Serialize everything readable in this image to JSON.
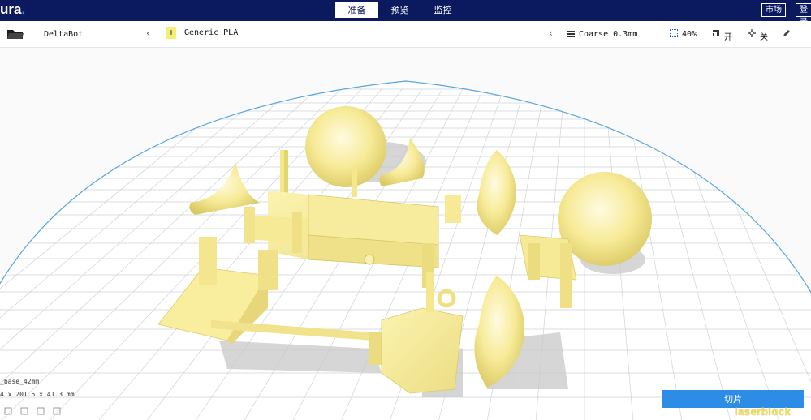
{
  "header": {
    "logo_text": "ura",
    "logo_dot": ".",
    "stages": [
      {
        "label": "准备",
        "active": true
      },
      {
        "label": "预览",
        "active": false
      },
      {
        "label": "监控",
        "active": false
      }
    ],
    "marketplace_label": "市场",
    "login_label": "登录"
  },
  "toolbar": {
    "printer_name": "DeltaBot",
    "material_name": "Generic PLA",
    "profile": "Coarse 0.3mm",
    "infill": "40%",
    "support": "开",
    "adhesion": "关"
  },
  "model_info": {
    "name": "_base_42mm",
    "dimensions": "4 x 201.5 x 41.3 mm"
  },
  "slice_button_label": "切片",
  "watermark_text": "laserblock",
  "colors": {
    "header_bg": "#0b1a5e",
    "model_color": "#f7ee9a",
    "slice_button": "#2d8ce6",
    "build_plate_edge": "#5aa6dc"
  }
}
